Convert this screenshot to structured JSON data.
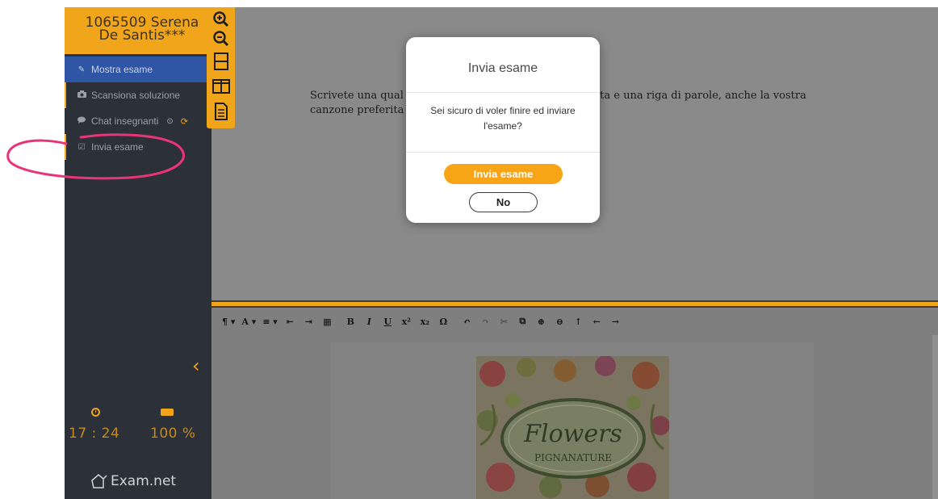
{
  "sidebar": {
    "student_name": "1065509 Serena De Santis***",
    "items": [
      {
        "label": "Mostra esame",
        "icon": "edit-icon"
      },
      {
        "label": "Scansiona soluzione",
        "icon": "camera-icon"
      },
      {
        "label": "Chat insegnanti",
        "icon": "chat-icon"
      },
      {
        "label": "Invia esame",
        "icon": "checkbox-icon"
      }
    ],
    "time": "17 : 24",
    "battery": "100 %",
    "logo_text": "Exam.net"
  },
  "document": {
    "line1": "Scrivete una qual                                                         ata e una riga di parole, anche la vostra",
    "line2": "canzone preferita"
  },
  "image": {
    "caption_main": "Flowers",
    "caption_sub": "PIGNANATURE"
  },
  "editor_toolbar": {
    "items": [
      "¶ ▾",
      "A ▾",
      "≡ ▾",
      "⇤",
      "⇥",
      "▦",
      "B",
      "I",
      "U",
      "x²",
      "x₂",
      "Ω",
      "↶",
      "↷",
      "✂",
      "⧉",
      "⊕",
      "⊖",
      "↑",
      "←",
      "→"
    ]
  },
  "modal": {
    "title": "Invia esame",
    "message": "Sei sicuro di voler finire ed inviare l'esame?",
    "confirm_label": "Invia esame",
    "cancel_label": "No"
  },
  "colors": {
    "accent": "#f1a51a",
    "sidebar_bg": "#2c3038",
    "active_item": "#2f56a4",
    "annotation": "#e8357a"
  }
}
